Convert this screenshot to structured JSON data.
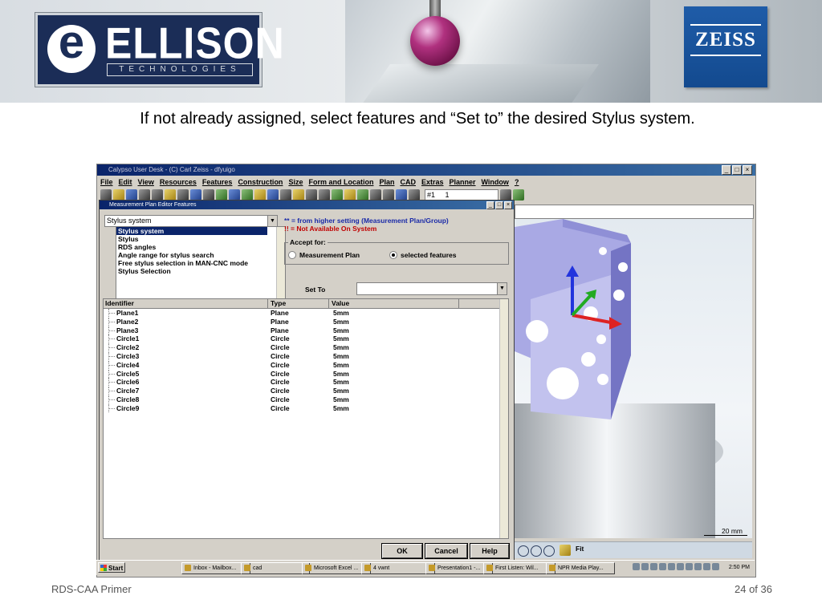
{
  "header": {
    "left_logo": {
      "wordmark": "ELLISON",
      "tagline": "TECHNOLOGIES",
      "monogram": "e"
    },
    "right_logo": {
      "wordmark": "ZEISS"
    }
  },
  "caption": "If not already assigned, select features and “Set to” the desired Stylus system.",
  "app": {
    "title": "Calypso User Desk - (C) Carl Zeiss - dfyuigo",
    "menu": [
      "File",
      "Edit",
      "View",
      "Resources",
      "Features",
      "Construction",
      "Size",
      "Form and Location",
      "Plan",
      "CAD",
      "Extras",
      "Planner",
      "Window",
      "?"
    ],
    "toolbar_combo": {
      "label": "#1",
      "value": "1"
    },
    "viewport": {
      "scale_label": "20 mm",
      "fit_label": "Fit"
    }
  },
  "dialog": {
    "title": "Measurement Plan Editor Features",
    "category_select": "Stylus system",
    "category_options": [
      "Stylus system",
      "Stylus",
      "RDS angles",
      "Angle range for stylus search",
      "Free stylus selection in MAN-CNC mode",
      "Stylus Selection"
    ],
    "note_inherited": "** = from higher setting (Measurement Plan/Group)",
    "note_unavailable": "!! = Not Available On System",
    "accept_for": {
      "legend": "Accept for:",
      "options": [
        {
          "label": "Measurement Plan",
          "selected": false
        },
        {
          "label": "selected features",
          "selected": true
        }
      ]
    },
    "set_to": {
      "label": "Set To",
      "value": ""
    },
    "table": {
      "columns": [
        "Identifier",
        "Type",
        "Value"
      ],
      "rows": [
        {
          "identifier": "Plane1",
          "type": "Plane",
          "value": "5mm"
        },
        {
          "identifier": "Plane2",
          "type": "Plane",
          "value": "5mm"
        },
        {
          "identifier": "Plane3",
          "type": "Plane",
          "value": "5mm"
        },
        {
          "identifier": "Circle1",
          "type": "Circle",
          "value": "5mm"
        },
        {
          "identifier": "Circle2",
          "type": "Circle",
          "value": "5mm"
        },
        {
          "identifier": "Circle3",
          "type": "Circle",
          "value": "5mm"
        },
        {
          "identifier": "Circle4",
          "type": "Circle",
          "value": "5mm"
        },
        {
          "identifier": "Circle5",
          "type": "Circle",
          "value": "5mm"
        },
        {
          "identifier": "Circle6",
          "type": "Circle",
          "value": "5mm"
        },
        {
          "identifier": "Circle7",
          "type": "Circle",
          "value": "5mm"
        },
        {
          "identifier": "Circle8",
          "type": "Circle",
          "value": "5mm"
        },
        {
          "identifier": "Circle9",
          "type": "Circle",
          "value": "5mm"
        }
      ]
    },
    "buttons": {
      "ok": "OK",
      "cancel": "Cancel",
      "help": "Help"
    }
  },
  "taskbar": {
    "start": "Start",
    "tasks": [
      "Inbox - Mailbox...",
      "cad",
      "Microsoft Excel ...",
      "4 vwnt",
      "Presentation1 -...",
      "First Listen: Wil...",
      "NPR Media Play..."
    ],
    "clock": "2:50 PM"
  },
  "footer": {
    "left": "RDS-CAA Primer",
    "right": "24 of 36"
  },
  "colors": {
    "selection": "#0a246a",
    "note_blue": "#1a2aa8",
    "note_red": "#c00000",
    "zeiss_blue": "#1f5ca8",
    "ellison_navy": "#1b2d57"
  }
}
